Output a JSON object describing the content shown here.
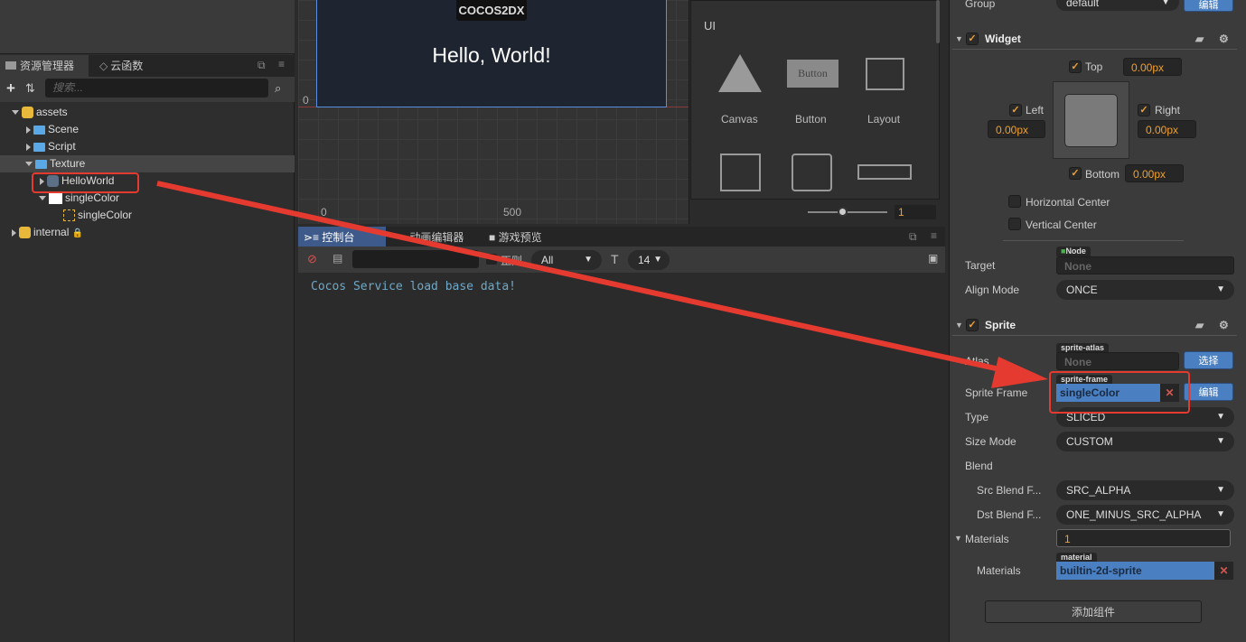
{
  "assets_panel": {
    "tabs": [
      {
        "label": "资源管理器",
        "icon": "folder-icon"
      },
      {
        "label": "云函数",
        "icon": "cloud-function-icon"
      }
    ],
    "search_placeholder": "搜索...",
    "tree": [
      {
        "label": "assets",
        "type": "db",
        "expanded": true
      },
      {
        "label": "Scene",
        "type": "folder"
      },
      {
        "label": "Script",
        "type": "folder"
      },
      {
        "label": "Texture",
        "type": "folder",
        "expanded": true,
        "selected": true
      },
      {
        "label": "HelloWorld",
        "type": "texture",
        "highlighted": true
      },
      {
        "label": "singleColor",
        "type": "texture",
        "expanded": true
      },
      {
        "label": "singleColor",
        "type": "sprite-frame"
      },
      {
        "label": "internal",
        "type": "db",
        "locked": true
      }
    ]
  },
  "scene": {
    "logo": "COCOS2DX",
    "hello_text": "Hello, World!",
    "axis_labels": {
      "y0": "0",
      "x0": "0",
      "x500": "500"
    }
  },
  "widget_library": {
    "section": "UI",
    "items": [
      {
        "label": "Canvas"
      },
      {
        "label": "Button",
        "preview": "Button"
      },
      {
        "label": "Layout"
      },
      {
        "label": ""
      },
      {
        "label": ""
      },
      {
        "label": ""
      }
    ],
    "zoom_value": "1"
  },
  "console": {
    "tabs": [
      {
        "label": "控制台",
        "active": true
      },
      {
        "label": "动画编辑器"
      },
      {
        "label": "游戏预览"
      }
    ],
    "regex_label": "正则",
    "level_filter": "All",
    "font_size": "14",
    "log_lines": [
      "Cocos Service load base data!"
    ],
    "log_color": "#6fa8c8"
  },
  "inspector": {
    "group": {
      "label": "Group",
      "value": "default",
      "button": "编辑"
    },
    "widget": {
      "title": "Widget",
      "enabled": true,
      "top": {
        "label": "Top",
        "checked": true,
        "value": "0.00px"
      },
      "left": {
        "label": "Left",
        "checked": true,
        "value": "0.00px"
      },
      "right": {
        "label": "Right",
        "checked": true,
        "value": "0.00px"
      },
      "bottom": {
        "label": "Bottom",
        "checked": true,
        "value": "0.00px"
      },
      "horizontal_center": {
        "label": "Horizontal Center",
        "checked": false
      },
      "vertical_center": {
        "label": "Vertical Center",
        "checked": false
      },
      "target": {
        "label": "Target",
        "tag": "Node",
        "value": "None"
      },
      "align_mode": {
        "label": "Align Mode",
        "value": "ONCE"
      }
    },
    "sprite": {
      "title": "Sprite",
      "enabled": true,
      "atlas": {
        "label": "Atlas",
        "tag": "sprite-atlas",
        "value": "None",
        "button": "选择"
      },
      "sprite_frame": {
        "label": "Sprite Frame",
        "tag": "sprite-frame",
        "value": "singleColor",
        "button": "编辑"
      },
      "type": {
        "label": "Type",
        "value": "SLICED"
      },
      "size_mode": {
        "label": "Size Mode",
        "value": "CUSTOM"
      },
      "blend": {
        "label": "Blend"
      },
      "src_blend": {
        "label": "Src Blend F...",
        "value": "SRC_ALPHA"
      },
      "dst_blend": {
        "label": "Dst Blend F...",
        "value": "ONE_MINUS_SRC_ALPHA"
      },
      "materials_count": {
        "label": "Materials",
        "value": "1"
      },
      "materials": {
        "label": "Materials",
        "tag": "material",
        "value": "builtin-2d-sprite"
      }
    },
    "add_component": "添加组件"
  },
  "annotation_color": "#e53a2f"
}
